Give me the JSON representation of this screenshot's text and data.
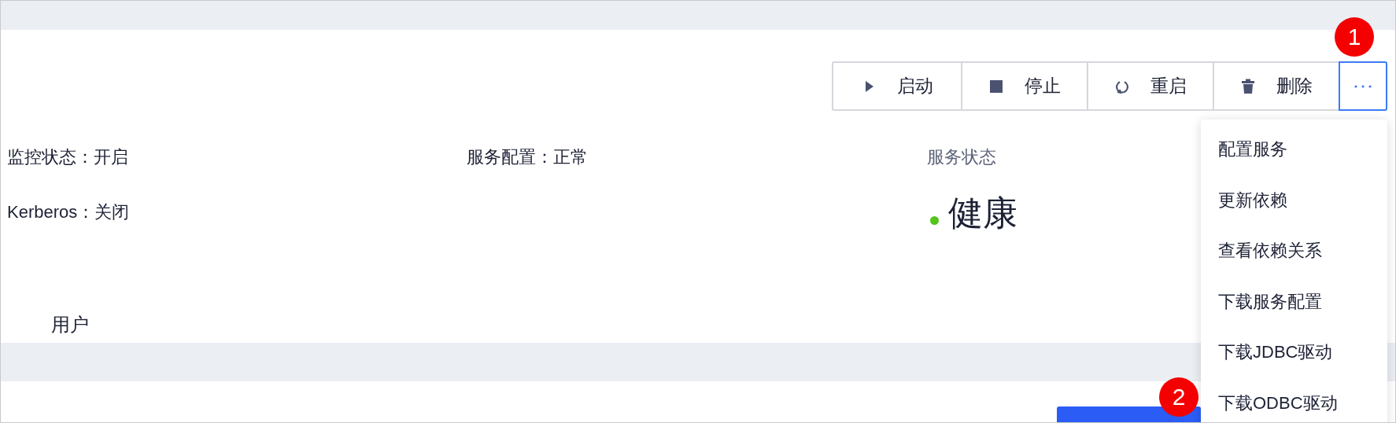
{
  "toolbar": {
    "buttons": [
      {
        "label": "启动",
        "kind": "play"
      },
      {
        "label": "停止",
        "kind": "stop"
      },
      {
        "label": "重启",
        "kind": "restart"
      },
      {
        "label": "删除",
        "kind": "delete"
      }
    ],
    "more_selected": true
  },
  "info": [
    "监控状态：开启",
    "服务配置：正常",
    "Kerberos：关闭"
  ],
  "service_status": {
    "label": "服务状态",
    "value": "健康"
  },
  "user_label": "用户",
  "dropdown": {
    "items": [
      "配置服务",
      "更新依赖",
      "查看依赖关系",
      "下载服务配置",
      "下载JDBC驱动",
      "下载ODBC驱动"
    ]
  },
  "callouts": [
    "1",
    "2"
  ]
}
